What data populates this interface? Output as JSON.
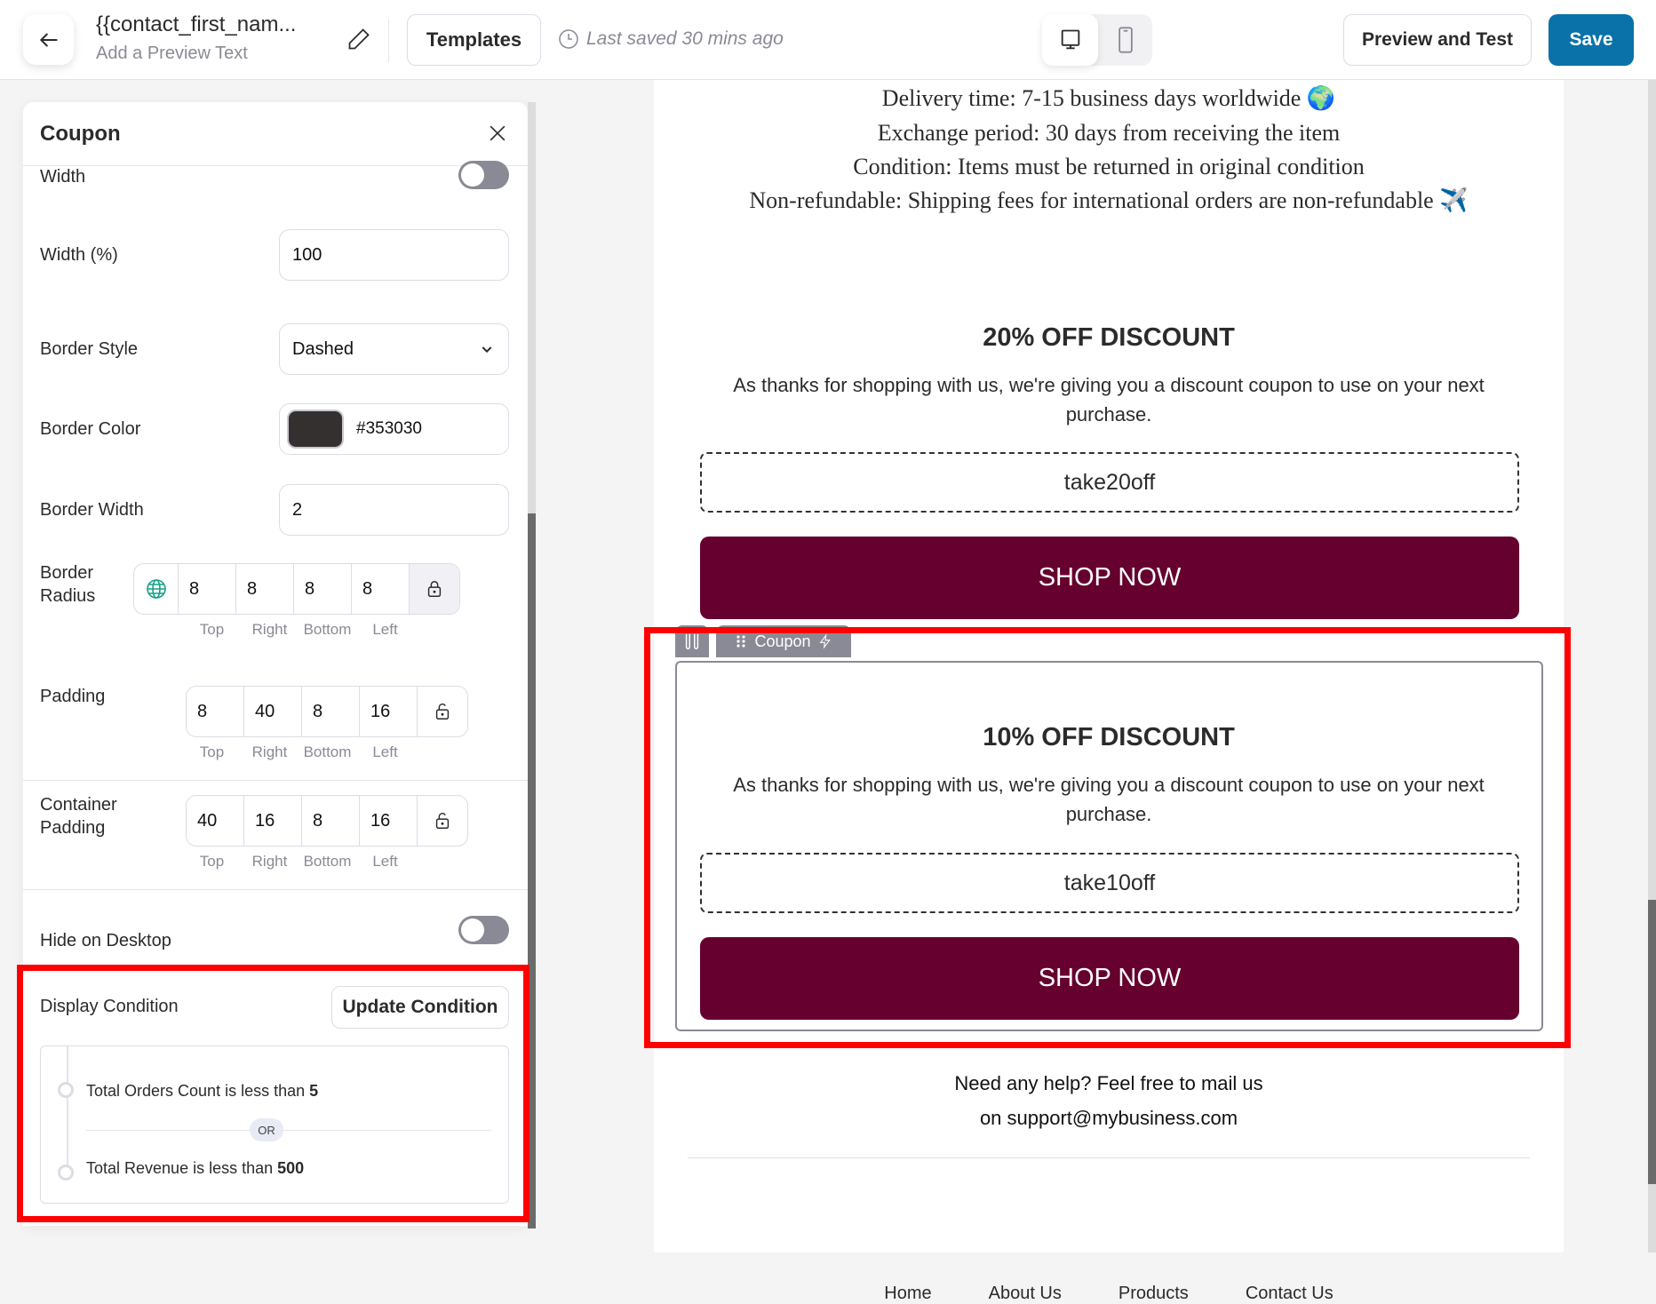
{
  "header": {
    "title": "{{contact_first_nam...",
    "subtitle": "Add a Preview Text",
    "templates_label": "Templates",
    "last_saved": "Last saved 30 mins ago",
    "preview_label": "Preview and Test",
    "save_label": "Save",
    "save_color": "#0a72a8"
  },
  "panel": {
    "title": "Coupon",
    "width_toggle_label": "Width",
    "width_toggle_on": false,
    "width_pct_label": "Width (%)",
    "width_pct_value": "100",
    "border_style_label": "Border Style",
    "border_style_value": "Dashed",
    "border_color_label": "Border Color",
    "border_color_value": "#353030",
    "border_width_label": "Border Width",
    "border_width_value": "2",
    "border_radius_label": "Border Radius",
    "border_radius": [
      "8",
      "8",
      "8",
      "8"
    ],
    "padding_label": "Padding",
    "padding": [
      "8",
      "40",
      "8",
      "16"
    ],
    "container_padding_label": "Container Padding",
    "container_padding": [
      "40",
      "16",
      "8",
      "16"
    ],
    "sides": [
      "Top",
      "Right",
      "Bottom",
      "Left"
    ],
    "hide_desktop_label": "Hide on Desktop",
    "hide_desktop_on": false,
    "display_condition_label": "Display Condition",
    "update_condition_label": "Update Condition",
    "conditions": [
      {
        "text": "Total Orders Count is less than ",
        "value": "5"
      },
      {
        "text": "Total Revenue is less than ",
        "value": "500"
      }
    ],
    "or_label": "OR"
  },
  "canvas": {
    "policy_lines": [
      "Delivery time: 7-15 business days worldwide 🌍",
      "Exchange period: 30 days from receiving the item",
      "Condition: Items must be returned in original condition",
      "Non-refundable: Shipping fees for international orders are non-refundable ✈️"
    ],
    "coupon1": {
      "heading": "20% OFF DISCOUNT",
      "desc": "As thanks for shopping with us, we're giving you a discount coupon to use on your next purchase.",
      "code": "take20off",
      "button": "SHOP NOW"
    },
    "block_tag": "Coupon",
    "coupon2": {
      "heading": "10% OFF DISCOUNT",
      "desc": "As thanks for shopping with us, we're giving you a discount coupon to use on your next purchase.",
      "code": "take10off",
      "button": "SHOP NOW"
    },
    "button_color": "#66002e",
    "help_line1": "Need any help? Feel free to mail us",
    "help_line2": "on support@mybusiness.com",
    "footer_links": [
      "Home",
      "About Us",
      "Products",
      "Contact Us"
    ]
  }
}
